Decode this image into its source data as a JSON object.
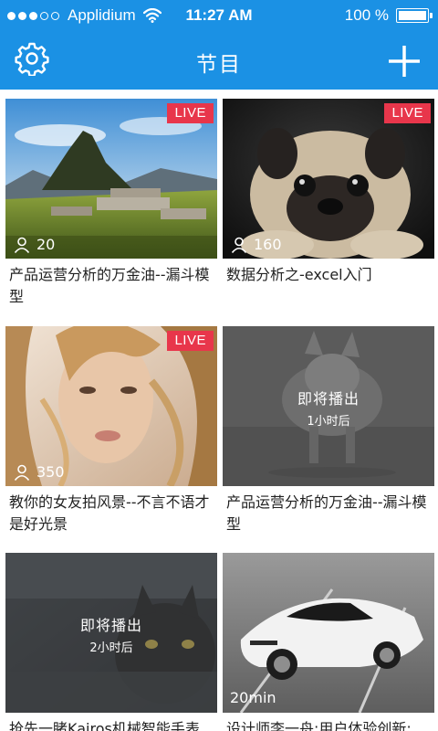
{
  "status_bar": {
    "carrier": "Applidium",
    "time": "11:27 AM",
    "battery": "100 %"
  },
  "nav": {
    "title": "节目",
    "left_icon": "gear-icon",
    "right_icon": "plus-icon"
  },
  "programs": [
    {
      "title": "产品运营分析的万金油--漏斗模型",
      "live_label": "LIVE",
      "viewers": "20",
      "image": "mountain-ruins"
    },
    {
      "title": "数据分析之-excel入门",
      "live_label": "LIVE",
      "viewers": "160",
      "image": "pug-dog"
    },
    {
      "title": "教你的女友拍风景--不言不语才是好光景",
      "live_label": "LIVE",
      "viewers": "350",
      "image": "woman-portrait"
    },
    {
      "title": "产品运营分析的万金油--漏斗模型",
      "upcoming_label": "即将播出",
      "upcoming_time": "1小时后",
      "image": "wolf"
    },
    {
      "title": "抢先一睹Kairos机械智能手表",
      "upcoming_label": "即将播出",
      "upcoming_time": "2小时后",
      "image": "black-cat"
    },
    {
      "title": "设计师李一舟:用户体验创新:",
      "duration": "20min",
      "image": "white-sports-car"
    }
  ],
  "colors": {
    "header": "#1b91e4",
    "live_badge": "#e8364b"
  }
}
